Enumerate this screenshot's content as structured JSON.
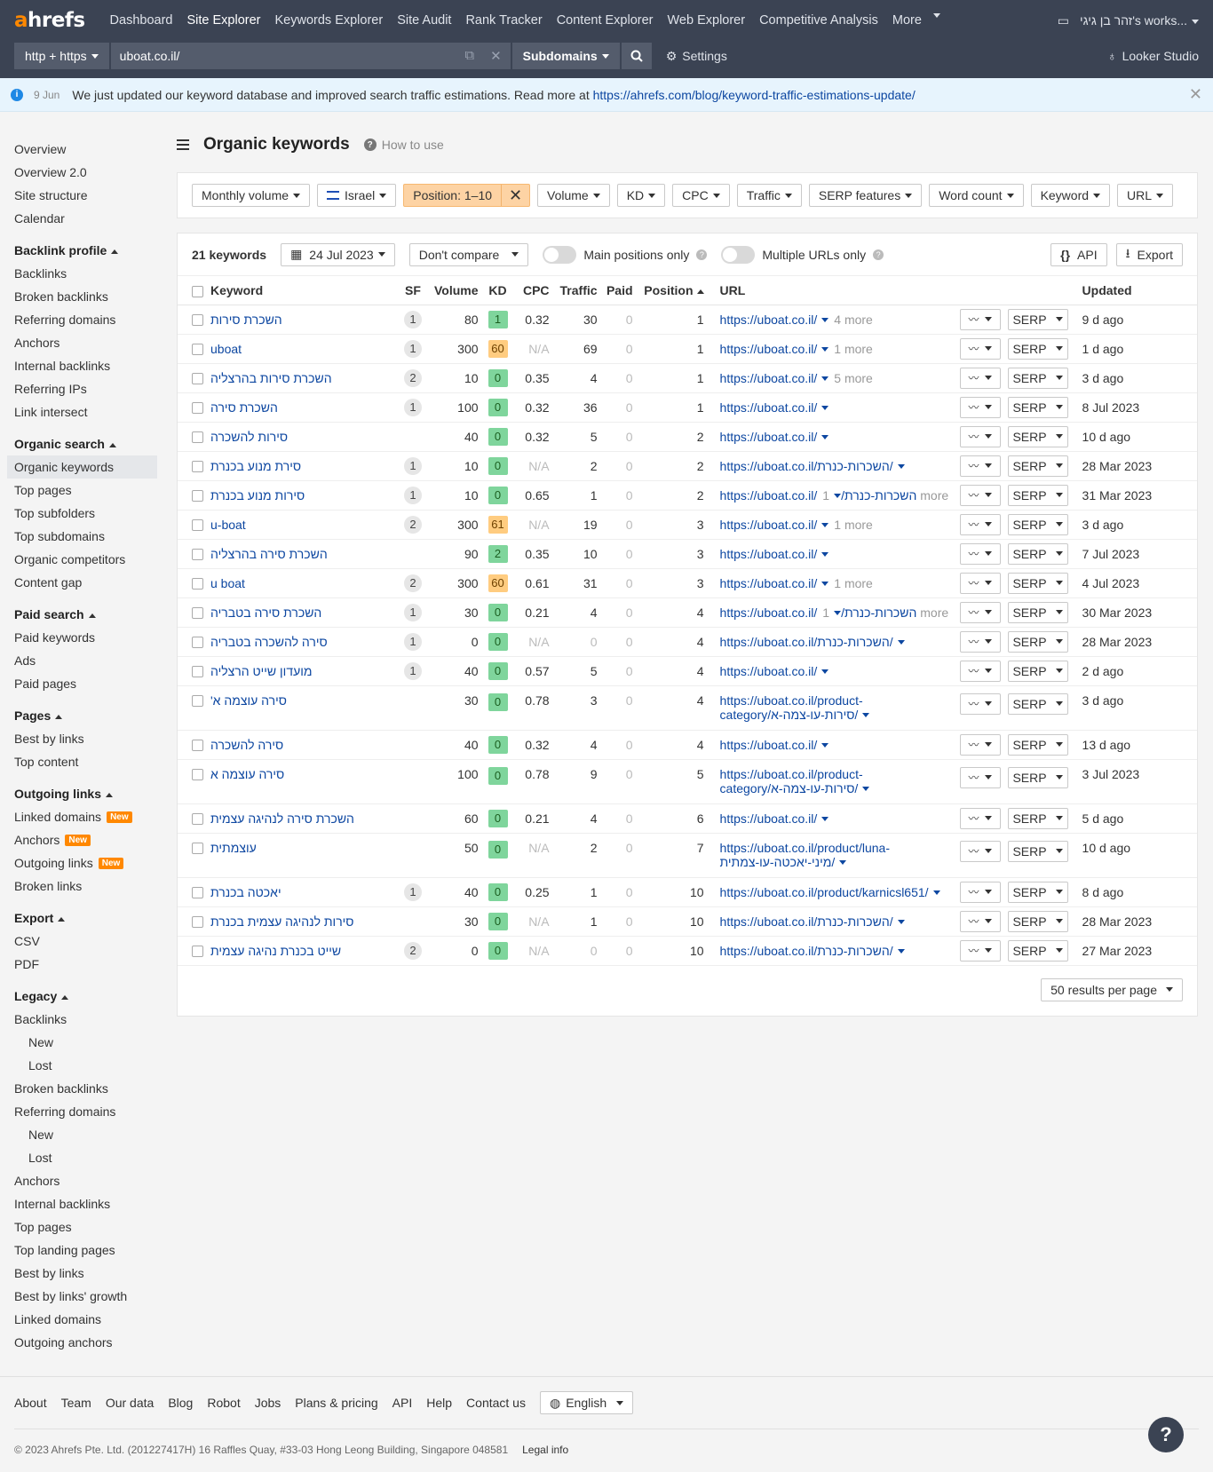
{
  "topnav": {
    "logo_a": "a",
    "logo_rest": "hrefs",
    "links": [
      "Dashboard",
      "Site Explorer",
      "Keywords Explorer",
      "Site Audit",
      "Rank Tracker",
      "Content Explorer",
      "Web Explorer",
      "Competitive Analysis",
      "More"
    ],
    "active_link": "Site Explorer",
    "workspace": "זהר בן גיגי's works..."
  },
  "searchbar": {
    "protocol": "http + https",
    "target": "uboat.co.il/",
    "mode": "Subdomains",
    "settings": "Settings",
    "looker": "Looker Studio"
  },
  "notice": {
    "date": "9 Jun",
    "text": "We just updated our keyword database and improved search traffic estimations. Read more at",
    "link": "https://ahrefs.com/blog/keyword-traffic-estimations-update/"
  },
  "sidebar": {
    "top": [
      "Overview",
      "Overview 2.0",
      "Site structure",
      "Calendar"
    ],
    "backlink_profile": {
      "title": "Backlink profile",
      "items": [
        "Backlinks",
        "Broken backlinks",
        "Referring domains",
        "Anchors",
        "Internal backlinks",
        "Referring IPs",
        "Link intersect"
      ]
    },
    "organic_search": {
      "title": "Organic search",
      "items": [
        "Organic keywords",
        "Top pages",
        "Top subfolders",
        "Top subdomains",
        "Organic competitors",
        "Content gap"
      ]
    },
    "paid_search": {
      "title": "Paid search",
      "items": [
        "Paid keywords",
        "Ads",
        "Paid pages"
      ]
    },
    "pages": {
      "title": "Pages",
      "items": [
        "Best by links",
        "Top content"
      ]
    },
    "outgoing_links": {
      "title": "Outgoing links",
      "items": [
        "Linked domains",
        "Anchors",
        "Outgoing links",
        "Broken links"
      ],
      "new_badge": "New"
    },
    "export": {
      "title": "Export",
      "items": [
        "CSV",
        "PDF"
      ]
    },
    "legacy": {
      "title": "Legacy",
      "items": [
        "Backlinks",
        "New",
        "Lost",
        "Broken backlinks",
        "Referring domains",
        "New",
        "Lost",
        "Anchors",
        "Internal backlinks",
        "Top pages",
        "Top landing pages",
        "Best by links",
        "Best by links' growth",
        "Linked domains",
        "Outgoing anchors"
      ]
    }
  },
  "page": {
    "title": "Organic keywords",
    "how_to_use": "How to use"
  },
  "filters": {
    "monthly_volume": "Monthly volume",
    "country": "Israel",
    "position": "Position: 1–10",
    "others": [
      "Volume",
      "KD",
      "CPC",
      "Traffic",
      "SERP features",
      "Word count",
      "Keyword",
      "URL"
    ]
  },
  "toolbar": {
    "count": "21 keywords",
    "date": "24 Jul 2023",
    "compare": "Don't compare",
    "main_positions": "Main positions only",
    "multiple_urls": "Multiple URLs only",
    "api": "API",
    "export": "Export"
  },
  "table": {
    "headers": {
      "keyword": "Keyword",
      "sf": "SF",
      "volume": "Volume",
      "kd": "KD",
      "cpc": "CPC",
      "traffic": "Traffic",
      "paid": "Paid",
      "position": "Position",
      "url": "URL",
      "updated": "Updated"
    },
    "serp_label": "SERP",
    "rows": [
      {
        "kw": "השכרת סירות",
        "sf": "1",
        "vol": "80",
        "kd": "1",
        "kdc": "g",
        "cpc": "0.32",
        "traffic": "30",
        "paid": "0",
        "pos": "1",
        "url": "https://uboat.co.il/",
        "more": "4 more",
        "updated": "9 d ago"
      },
      {
        "kw": "uboat",
        "sf": "1",
        "vol": "300",
        "kd": "60",
        "kdc": "o",
        "cpc": "N/A",
        "traffic": "69",
        "paid": "0",
        "pos": "1",
        "url": "https://uboat.co.il/",
        "more": "1 more",
        "updated": "1 d ago"
      },
      {
        "kw": "השכרת סירות בהרצליה",
        "sf": "2",
        "vol": "10",
        "kd": "0",
        "kdc": "g",
        "cpc": "0.35",
        "traffic": "4",
        "paid": "0",
        "pos": "1",
        "url": "https://uboat.co.il/",
        "more": "5 more",
        "updated": "3 d ago"
      },
      {
        "kw": "השכרת סירה",
        "sf": "1",
        "vol": "100",
        "kd": "0",
        "kdc": "g",
        "cpc": "0.32",
        "traffic": "36",
        "paid": "0",
        "pos": "1",
        "url": "https://uboat.co.il/",
        "more": "",
        "updated": "8 Jul 2023"
      },
      {
        "kw": "סירות להשכרה",
        "sf": "",
        "vol": "40",
        "kd": "0",
        "kdc": "g",
        "cpc": "0.32",
        "traffic": "5",
        "paid": "0",
        "pos": "2",
        "url": "https://uboat.co.il/",
        "more": "",
        "updated": "10 d ago"
      },
      {
        "kw": "סירת מנוע בכנרת",
        "sf": "1",
        "vol": "10",
        "kd": "0",
        "kdc": "g",
        "cpc": "N/A",
        "traffic": "2",
        "paid": "0",
        "pos": "2",
        "url": "https://uboat.co.il/השכרות-כנרת/",
        "more": "",
        "updated": "28 Mar 2023"
      },
      {
        "kw": "סירות מנוע בכנרת",
        "sf": "1",
        "vol": "10",
        "kd": "0",
        "kdc": "g",
        "cpc": "0.65",
        "traffic": "1",
        "paid": "0",
        "pos": "2",
        "url": "https://uboat.co.il/השכרות-כנרת/",
        "more": "1 more",
        "updated": "31 Mar 2023"
      },
      {
        "kw": "u-boat",
        "sf": "2",
        "vol": "300",
        "kd": "61",
        "kdc": "o",
        "cpc": "N/A",
        "traffic": "19",
        "paid": "0",
        "pos": "3",
        "url": "https://uboat.co.il/",
        "more": "1 more",
        "updated": "3 d ago"
      },
      {
        "kw": "השכרת סירה בהרצליה",
        "sf": "",
        "vol": "90",
        "kd": "2",
        "kdc": "g",
        "cpc": "0.35",
        "traffic": "10",
        "paid": "0",
        "pos": "3",
        "url": "https://uboat.co.il/",
        "more": "",
        "updated": "7 Jul 2023"
      },
      {
        "kw": "u boat",
        "sf": "2",
        "vol": "300",
        "kd": "60",
        "kdc": "o",
        "cpc": "0.61",
        "traffic": "31",
        "paid": "0",
        "pos": "3",
        "url": "https://uboat.co.il/",
        "more": "1 more",
        "updated": "4 Jul 2023"
      },
      {
        "kw": "השכרת סירה בטבריה",
        "sf": "1",
        "vol": "30",
        "kd": "0",
        "kdc": "g",
        "cpc": "0.21",
        "traffic": "4",
        "paid": "0",
        "pos": "4",
        "url": "https://uboat.co.il/השכרות-כנרת/",
        "more": "1 more",
        "updated": "30 Mar 2023"
      },
      {
        "kw": "סירה להשכרה בטבריה",
        "sf": "1",
        "vol": "0",
        "kd": "0",
        "kdc": "g",
        "cpc": "N/A",
        "traffic": "0",
        "paid": "0",
        "pos": "4",
        "url": "https://uboat.co.il/השכרות-כנרת/",
        "more": "",
        "updated": "28 Mar 2023"
      },
      {
        "kw": "מועדון שייט הרצליה",
        "sf": "1",
        "vol": "40",
        "kd": "0",
        "kdc": "g",
        "cpc": "0.57",
        "traffic": "5",
        "paid": "0",
        "pos": "4",
        "url": "https://uboat.co.il/",
        "more": "",
        "updated": "2 d ago"
      },
      {
        "kw": "סירה עוצמה א'",
        "sf": "",
        "vol": "30",
        "kd": "0",
        "kdc": "g",
        "cpc": "0.78",
        "traffic": "3",
        "paid": "0",
        "pos": "4",
        "url": "https://uboat.co.il/product-category/סירות-עו-צמה-א/",
        "more": "",
        "updated": "3 d ago",
        "tall": true
      },
      {
        "kw": "סירה להשכרה",
        "sf": "",
        "vol": "40",
        "kd": "0",
        "kdc": "g",
        "cpc": "0.32",
        "traffic": "4",
        "paid": "0",
        "pos": "4",
        "url": "https://uboat.co.il/",
        "more": "",
        "updated": "13 d ago"
      },
      {
        "kw": "סירה עוצמה א",
        "sf": "",
        "vol": "100",
        "kd": "0",
        "kdc": "g",
        "cpc": "0.78",
        "traffic": "9",
        "paid": "0",
        "pos": "5",
        "url": "https://uboat.co.il/product-category/סירות-עו-צמה-א/",
        "more": "",
        "updated": "3 Jul 2023",
        "tall": true
      },
      {
        "kw": "השכרת סירה לנהיגה עצמית",
        "sf": "",
        "vol": "60",
        "kd": "0",
        "kdc": "g",
        "cpc": "0.21",
        "traffic": "4",
        "paid": "0",
        "pos": "6",
        "url": "https://uboat.co.il/",
        "more": "",
        "updated": "5 d ago"
      },
      {
        "kw": "עוצמתית",
        "sf": "",
        "vol": "50",
        "kd": "0",
        "kdc": "g",
        "cpc": "N/A",
        "traffic": "2",
        "paid": "0",
        "pos": "7",
        "url": "https://uboat.co.il/product/luna-מיני-יאכטה-עו-צמתית/",
        "more": "",
        "updated": "10 d ago",
        "tall": true
      },
      {
        "kw": "יאכטה בכנרת",
        "sf": "1",
        "vol": "40",
        "kd": "0",
        "kdc": "g",
        "cpc": "0.25",
        "traffic": "1",
        "paid": "0",
        "pos": "10",
        "url": "https://uboat.co.il/product/karnicsl651/",
        "more": "",
        "updated": "8 d ago"
      },
      {
        "kw": "סירות לנהיגה עצמית בכנרת",
        "sf": "",
        "vol": "30",
        "kd": "0",
        "kdc": "g",
        "cpc": "N/A",
        "traffic": "1",
        "paid": "0",
        "pos": "10",
        "url": "https://uboat.co.il/השכרות-כנרת/",
        "more": "",
        "updated": "28 Mar 2023"
      },
      {
        "kw": "שייט בכנרת נהיגה עצמית",
        "sf": "2",
        "vol": "0",
        "kd": "0",
        "kdc": "g",
        "cpc": "N/A",
        "traffic": "0",
        "paid": "0",
        "pos": "10",
        "url": "https://uboat.co.il/השכרות-כנרת/",
        "more": "",
        "updated": "27 Mar 2023"
      }
    ]
  },
  "pager": {
    "per_page": "50 results per page"
  },
  "footer": {
    "links": [
      "About",
      "Team",
      "Our data",
      "Blog",
      "Robot",
      "Jobs",
      "Plans & pricing",
      "API",
      "Help",
      "Contact us"
    ],
    "language": "English",
    "copyright": "© 2023 Ahrefs Pte. Ltd. (201227417H) 16 Raffles Quay, #33-03 Hong Leong Building, Singapore 048581",
    "legal": "Legal info",
    "help_label": "?"
  },
  "colors": {
    "nav_bg": "#3b4353",
    "brand_orange": "#ff8800",
    "link_blue": "#0d47a1",
    "kd_green": "#7fd59c",
    "kd_orange": "#ffcc80"
  }
}
